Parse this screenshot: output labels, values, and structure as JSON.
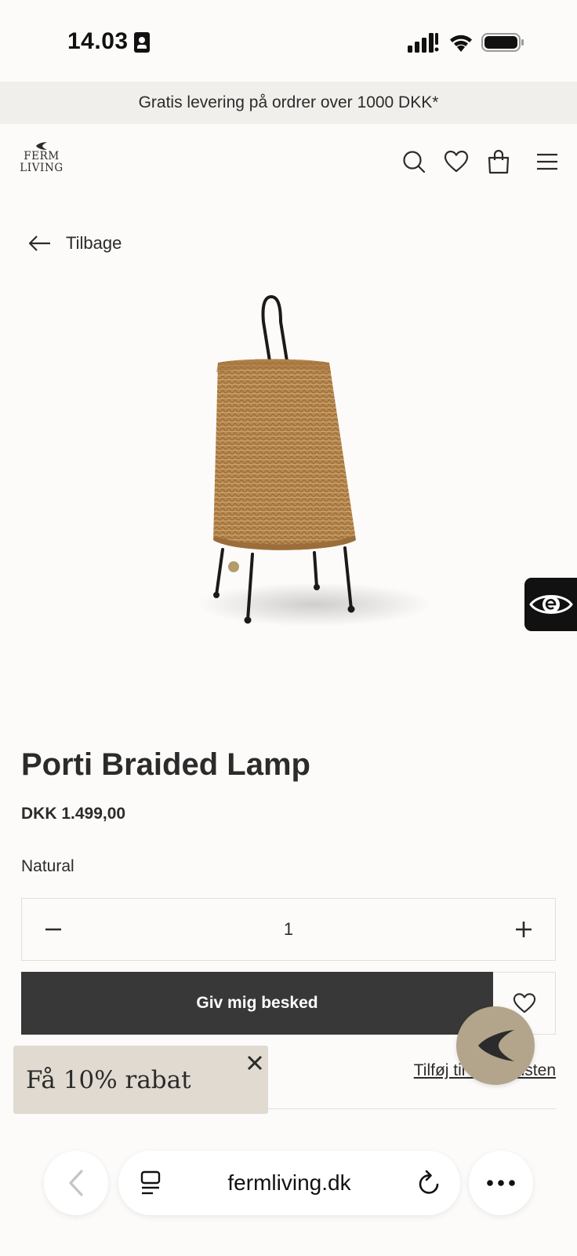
{
  "status_bar": {
    "time": "14.03"
  },
  "promo_banner": {
    "text": "Gratis levering på ordrer over 1000 DKK*"
  },
  "header": {
    "logo_line1": "FERM",
    "logo_line2": "LIVING",
    "icons": [
      "search-icon",
      "heart-icon",
      "bag-icon",
      "menu-icon"
    ]
  },
  "back_link": {
    "label": "Tilbage"
  },
  "product": {
    "title": "Porti Braided Lamp",
    "price": "DKK 1.499,00",
    "variant": "Natural",
    "quantity": "1",
    "notify_label": "Giv mig besked",
    "wishlist_link": "Tilføj til Ønskelisten"
  },
  "discount_popup": {
    "text": "Få 10% rabat"
  },
  "browser": {
    "url": "fermliving.dk"
  },
  "colors": {
    "background": "#fcfbf9",
    "banner": "#f1efec",
    "button_dark": "#383838",
    "popup": "#e1dad1",
    "chat": "#b3a48c"
  }
}
